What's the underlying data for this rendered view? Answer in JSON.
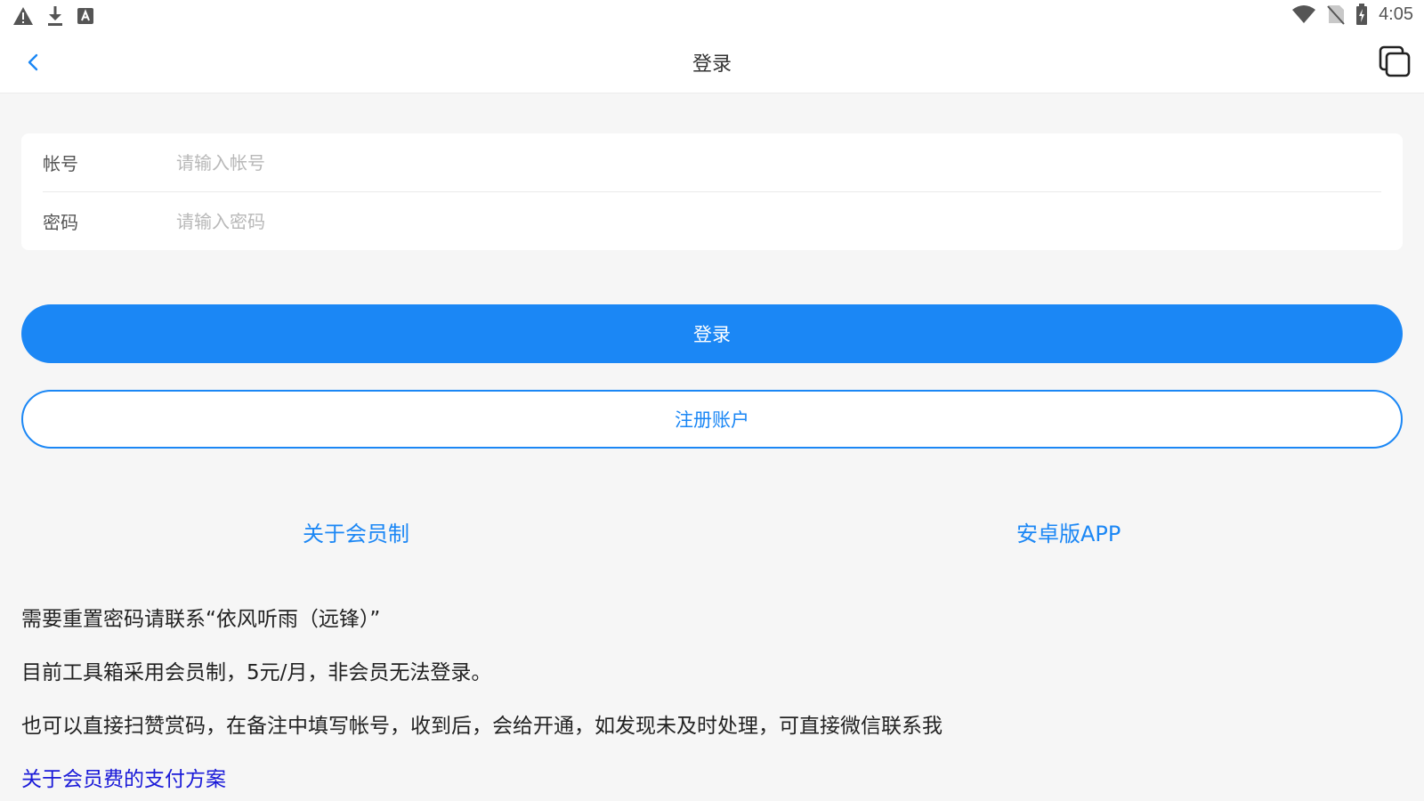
{
  "status_bar": {
    "left_icons": [
      "warning-icon",
      "download-icon",
      "keyboard-icon"
    ],
    "right_icons": [
      "wifi-icon",
      "no-sim-icon",
      "battery-icon"
    ],
    "time": "4:05"
  },
  "nav": {
    "title": "登录",
    "back_icon": "chevron-left-icon",
    "window_icon": "overlapping-squares-icon"
  },
  "form": {
    "account_label": "帐号",
    "account_placeholder": "请输入帐号",
    "account_value": "",
    "password_label": "密码",
    "password_placeholder": "请输入密码",
    "password_value": ""
  },
  "buttons": {
    "login": "登录",
    "register": "注册账户"
  },
  "links": {
    "about_membership": "关于会员制",
    "android_app": "安卓版APP",
    "payment_plan": "关于会员费的支付方案"
  },
  "info": {
    "line1": "需要重置密码请联系“依风听雨（远锋）”",
    "line2": "目前工具箱采用会员制，5元/月，非会员无法登录。",
    "line3": "也可以直接扫赞赏码，在备注中填写帐号，收到后，会给开通，如发现未及时处理，可直接微信联系我"
  },
  "colors": {
    "accent": "#1b87f5",
    "page_bg": "#f6f6f6",
    "link_dark": "#1a1ad8"
  }
}
